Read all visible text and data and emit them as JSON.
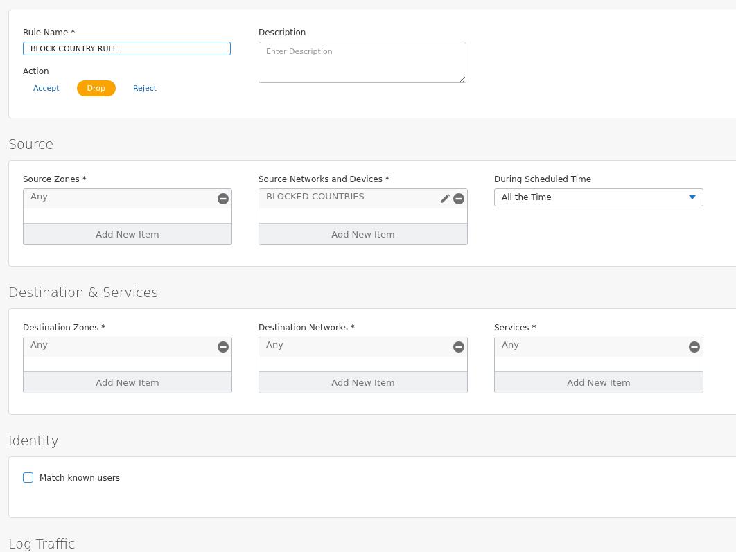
{
  "rule": {
    "name_label": "Rule Name *",
    "name_value": "BLOCK COUNTRY RULE",
    "action_label": "Action",
    "actions": [
      {
        "label": "Accept",
        "selected": false
      },
      {
        "label": "Drop",
        "selected": true
      },
      {
        "label": "Reject",
        "selected": false
      }
    ],
    "description_label": "Description",
    "description_placeholder": "Enter Description"
  },
  "sections": [
    {
      "title": "Source",
      "fields": [
        {
          "kind": "list",
          "label": "Source Zones *",
          "items": [
            {
              "text": "Any",
              "editable": false
            }
          ],
          "add_label": "Add New Item"
        },
        {
          "kind": "list",
          "label": "Source Networks and Devices *",
          "items": [
            {
              "text": "BLOCKED COUNTRIES",
              "editable": true
            }
          ],
          "add_label": "Add New Item"
        },
        {
          "kind": "select",
          "label": "During Scheduled Time",
          "value": "All the Time"
        }
      ]
    },
    {
      "title": "Destination & Services",
      "fields": [
        {
          "kind": "list",
          "label": "Destination Zones *",
          "items": [
            {
              "text": "Any",
              "editable": false
            }
          ],
          "add_label": "Add New Item"
        },
        {
          "kind": "list",
          "label": "Destination Networks *",
          "items": [
            {
              "text": "Any",
              "editable": false
            }
          ],
          "add_label": "Add New Item"
        },
        {
          "kind": "list",
          "label": "Services *",
          "items": [
            {
              "text": "Any",
              "editable": false
            }
          ],
          "add_label": "Add New Item"
        }
      ]
    },
    {
      "title": "Identity",
      "fields": [
        {
          "kind": "checkbox",
          "label": "Match known users",
          "checked": false
        }
      ]
    },
    {
      "title": "Log Traffic"
    }
  ]
}
